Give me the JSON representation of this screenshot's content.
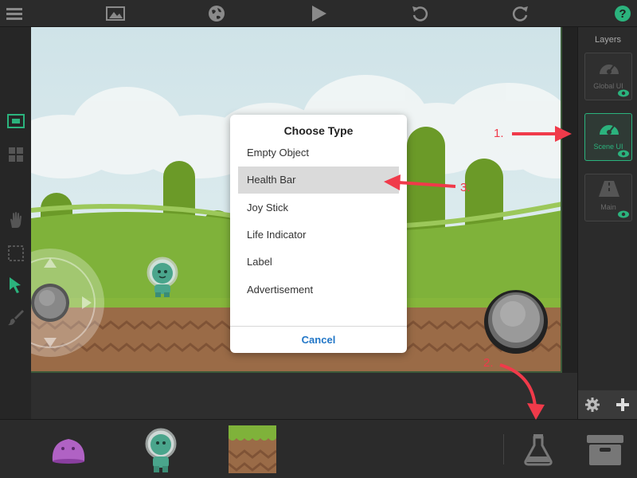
{
  "layers": {
    "title": "Layers",
    "items": [
      {
        "label": "Global UI",
        "active": false
      },
      {
        "label": "Scene UI",
        "active": true
      },
      {
        "label": "Main",
        "active": false
      }
    ]
  },
  "dialog": {
    "title": "Choose Type",
    "options": [
      "Empty Object",
      "Health Bar",
      "Joy Stick",
      "Life Indicator",
      "Label",
      "Advertisement"
    ],
    "selected": "Health Bar",
    "cancel": "Cancel"
  },
  "annotations": [
    "1.",
    "2.",
    "3."
  ],
  "colors": {
    "accent": "#2bb37d",
    "annotation": "#f03a4a",
    "link": "#2176c7"
  },
  "toolbar_icons": [
    "menu-icon",
    "image-icon",
    "globe-icon",
    "play-icon",
    "undo-icon",
    "redo-icon",
    "help-icon"
  ],
  "tool_icons": [
    "frame-icon",
    "grid-icon",
    "hand-icon",
    "selection-icon",
    "pointer-icon",
    "brush-icon"
  ],
  "palette_icons": [
    "slime-enemy-icon",
    "astronaut-character-icon",
    "ground-tile-icon",
    "flask-icon",
    "archive-icon"
  ],
  "panel_icons": [
    "gear-icon",
    "plus-icon"
  ]
}
